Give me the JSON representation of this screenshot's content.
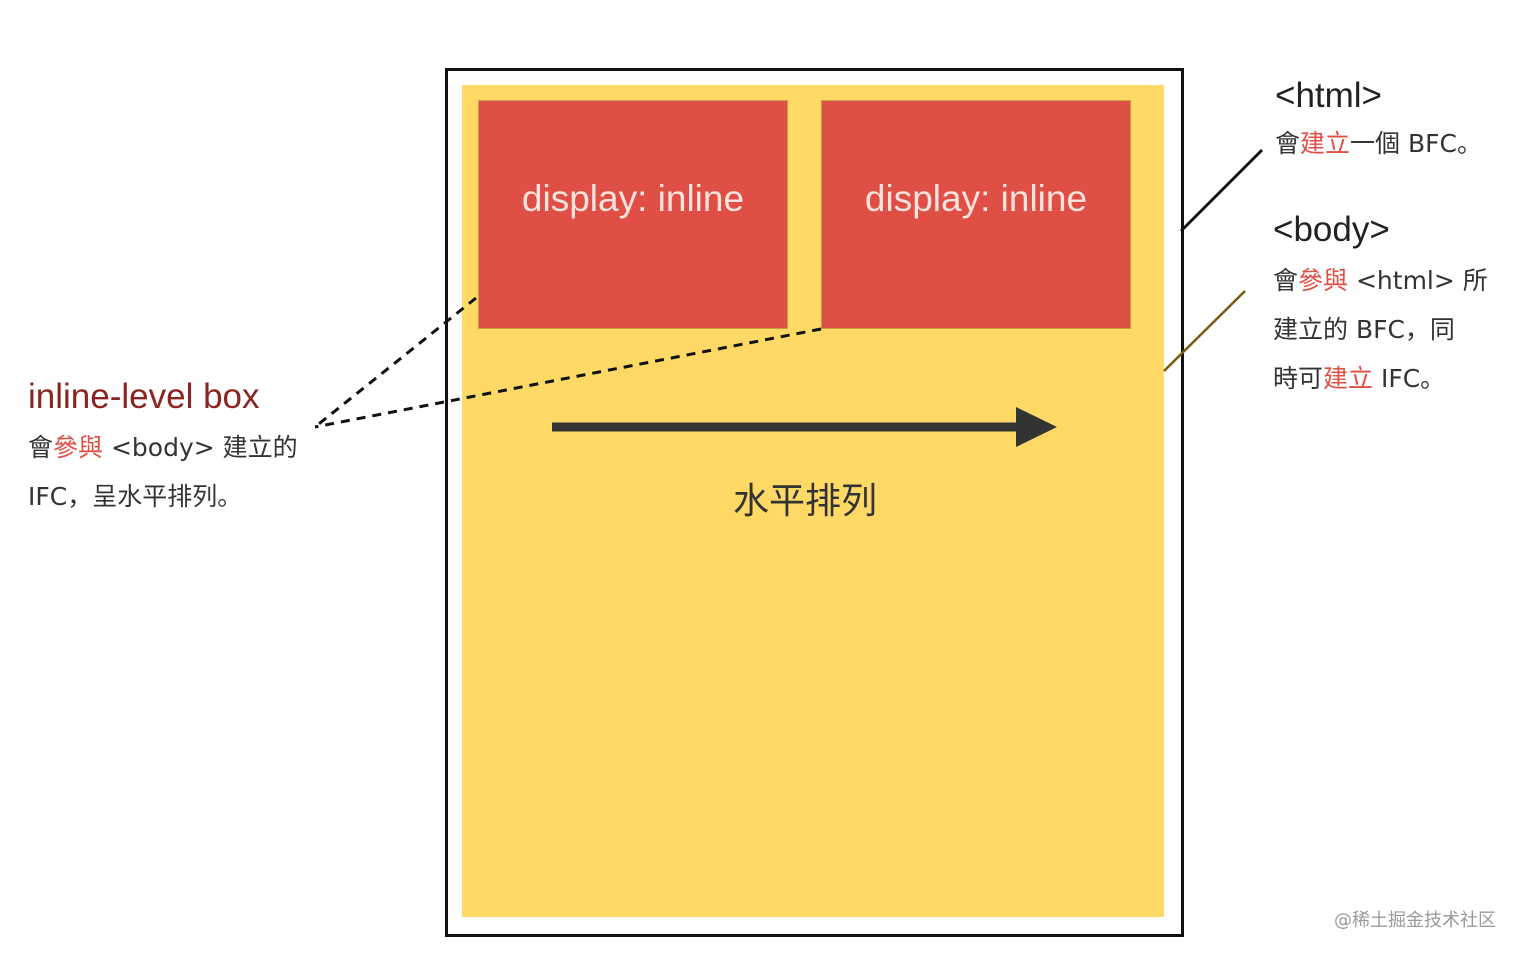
{
  "boxes": {
    "inline_1": "display: inline",
    "inline_2": "display: inline",
    "arrow_label": "水平排列"
  },
  "html_note": {
    "title": "<html>",
    "line1": {
      "a": "會",
      "b": "建立",
      "c": "一個 BFC。"
    }
  },
  "body_note": {
    "title": "<body>",
    "line1": {
      "a": "會",
      "b": "參與",
      "c": " <html> 所"
    },
    "line2": "建立的 BFC，同",
    "line3": {
      "a": "時可",
      "b": "建立",
      "c": " IFC。"
    }
  },
  "inline_note": {
    "title": "inline-level box",
    "line1": {
      "a": "會",
      "b": "參與",
      "c": " <body> 建立的"
    },
    "line2": "IFC，呈水平排列。"
  },
  "watermark": "@稀土掘金技术社区",
  "colors": {
    "body_fill": "#fed966",
    "inline_fill": "#e04f45",
    "frame": "#111111",
    "highlight": "#e04f45",
    "title_dark_red": "#8b2420",
    "arrow": "#333333",
    "body_connector": "#7a5a10"
  }
}
